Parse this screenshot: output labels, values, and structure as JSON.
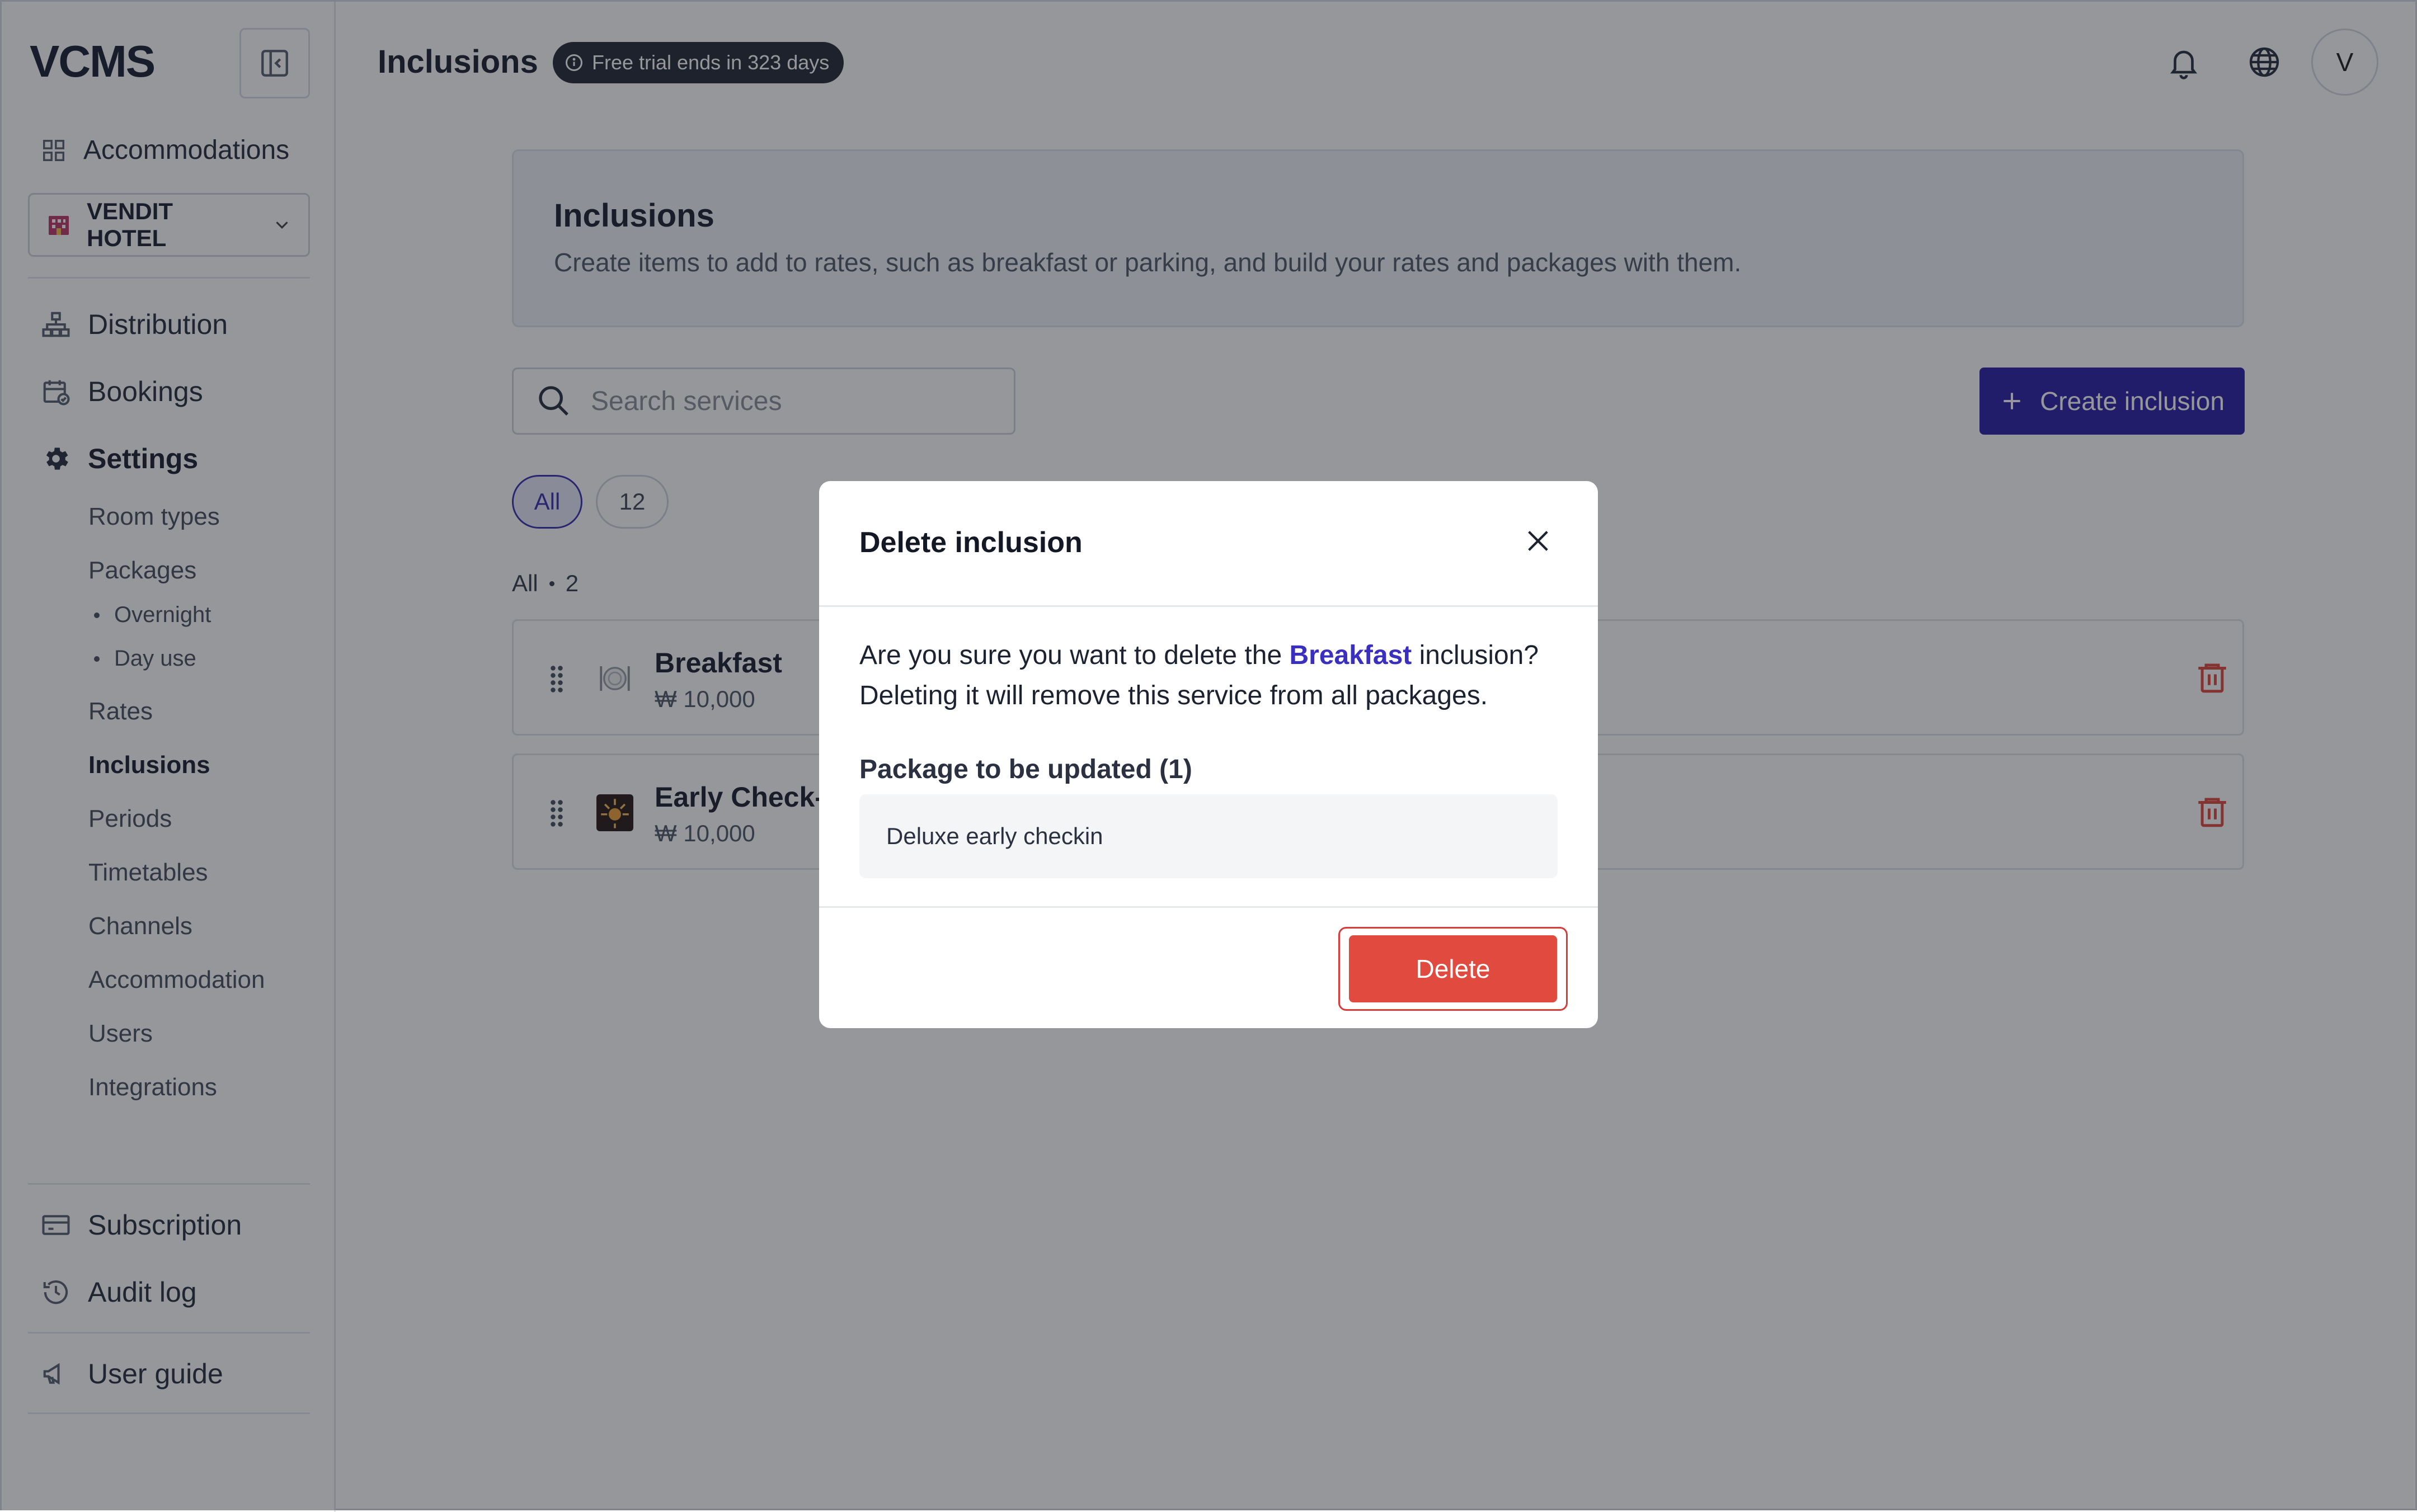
{
  "app": {
    "logo": "VCMS"
  },
  "sidebar": {
    "accommodations_label": "Accommodations",
    "hotel_name": "VENDIT HOTEL",
    "distribution_label": "Distribution",
    "bookings_label": "Bookings",
    "settings_label": "Settings",
    "settings_items": [
      "Room types",
      "Packages",
      "Rates",
      "Inclusions",
      "Periods",
      "Timetables",
      "Channels",
      "Accommodation",
      "Users",
      "Integrations"
    ],
    "packages_sub": [
      "Overnight",
      "Day use"
    ],
    "active_item": "Inclusions",
    "subscription_label": "Subscription",
    "audit_log_label": "Audit log",
    "user_guide_label": "User guide"
  },
  "header": {
    "title": "Inclusions",
    "trial_badge": "Free trial ends in 323 days",
    "avatar_initial": "V"
  },
  "main": {
    "card_title": "Inclusions",
    "card_description": "Create items to add to rates, such as breakfast or parking, and build your rates and packages with them.",
    "search_placeholder": "Search services",
    "create_button": "Create inclusion",
    "filters": [
      "All",
      "12"
    ],
    "list_label": "All",
    "list_count": "2",
    "items": [
      {
        "name": "Breakfast",
        "price": "₩ 10,000"
      },
      {
        "name": "Early Check-in",
        "price": "₩ 10,000"
      }
    ]
  },
  "modal": {
    "title": "Delete inclusion",
    "message_before": "Are you sure you want to delete the ",
    "highlight": "Breakfast",
    "message_after": " inclusion? Deleting it will remove this service from all packages.",
    "packages_title": "Package to be updated (1)",
    "package_name": "Deluxe early checkin",
    "delete_button": "Delete"
  },
  "colors": {
    "accent": "#2e22a8",
    "danger": "#e04a3f",
    "highlight": "#3b2fc0",
    "badge_bg": "#262b36"
  }
}
